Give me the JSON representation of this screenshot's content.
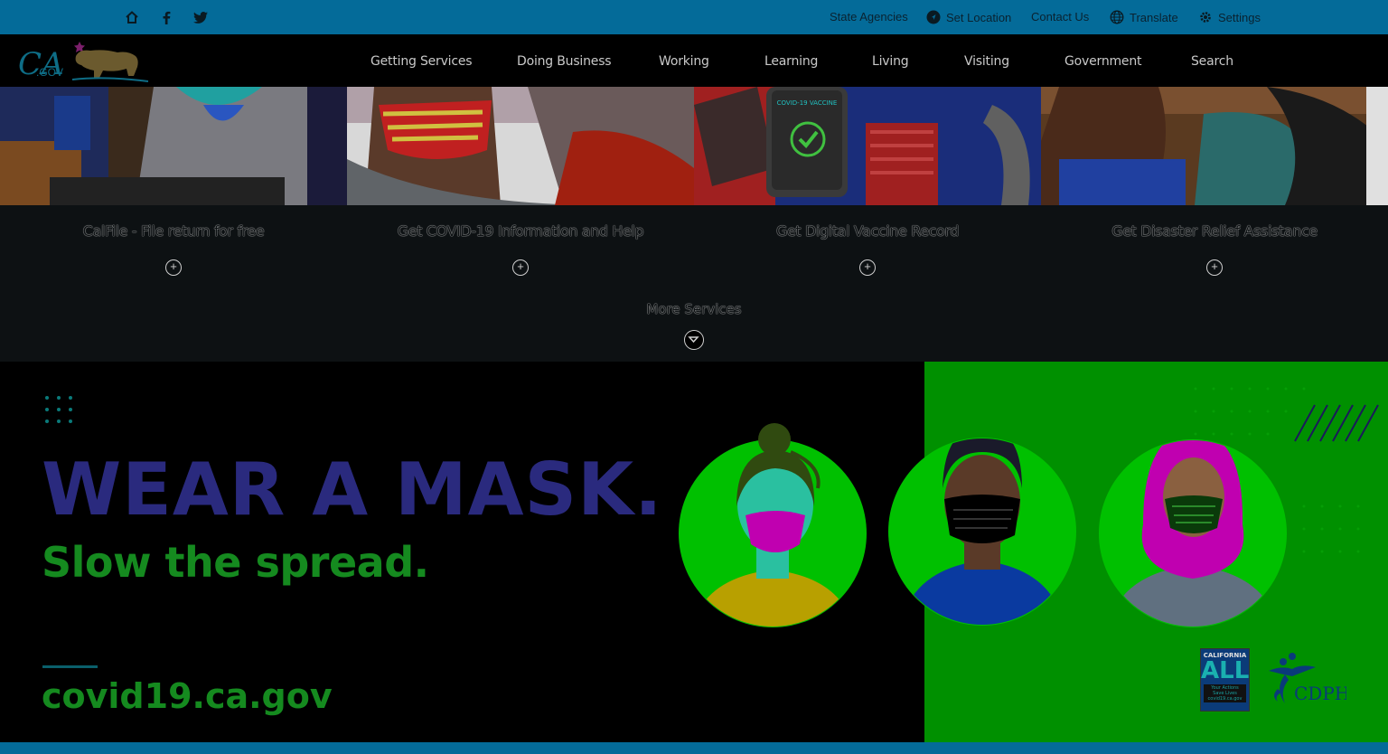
{
  "utility_bar": {
    "icons": [
      "home-icon",
      "facebook-icon",
      "twitter-icon"
    ],
    "links": [
      {
        "label": "State Agencies",
        "icon": ""
      },
      {
        "label": "Set Location",
        "icon": "location-icon"
      },
      {
        "label": "Contact Us",
        "icon": ""
      },
      {
        "label": "Translate",
        "icon": "globe-icon"
      },
      {
        "label": "Settings",
        "icon": "gear-icon"
      }
    ]
  },
  "logo": {
    "text": "CA.GOV",
    "icon": "bear-logo"
  },
  "nav": {
    "items": [
      "Getting Services",
      "Doing Business",
      "Working",
      "Learning",
      "Living",
      "Visiting",
      "Government",
      "Search"
    ]
  },
  "services": {
    "tiles": [
      {
        "title": "CalFile - File return for free"
      },
      {
        "title": "Get COVID-19 Information and Help"
      },
      {
        "title": "Get Digital Vaccine Record",
        "phone_caption": "COVID-19 VACCINE"
      },
      {
        "title": "Get Disaster Relief Assistance"
      }
    ],
    "more_label": "More Services"
  },
  "banner": {
    "headline": "WEAR A MASK.",
    "subhead": "Slow the spread.",
    "url": "covid19.ca.gov",
    "badge": {
      "top": "CALIFORNIA",
      "main": "ALL",
      "lines": [
        "Your Actions",
        "Save Lives",
        "covid19.ca.gov"
      ]
    },
    "partner": "CDPH"
  },
  "colors": {
    "topbar": "#046b99",
    "banner_green": "#009000",
    "headline": "#2a2a7e",
    "subhead": "#158a1f"
  }
}
